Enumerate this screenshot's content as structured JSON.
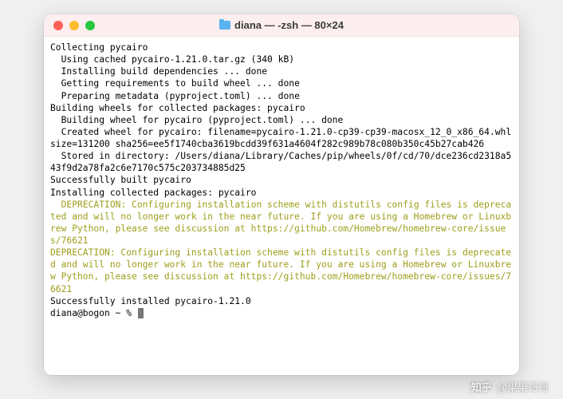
{
  "window": {
    "title": "diana — -zsh — 80×24"
  },
  "terminal": {
    "lines": [
      {
        "text": "Collecting pycairo",
        "cls": ""
      },
      {
        "text": "  Using cached pycairo-1.21.0.tar.gz (340 kB)",
        "cls": ""
      },
      {
        "text": "  Installing build dependencies ... done",
        "cls": ""
      },
      {
        "text": "  Getting requirements to build wheel ... done",
        "cls": ""
      },
      {
        "text": "  Preparing metadata (pyproject.toml) ... done",
        "cls": ""
      },
      {
        "text": "Building wheels for collected packages: pycairo",
        "cls": ""
      },
      {
        "text": "  Building wheel for pycairo (pyproject.toml) ... done",
        "cls": ""
      },
      {
        "text": "  Created wheel for pycairo: filename=pycairo-1.21.0-cp39-cp39-macosx_12_0_x86_64.whl size=131200 sha256=ee5f1740cba3619bcdd39f631a4604f282c989b78c080b350c45b27cab426",
        "cls": ""
      },
      {
        "text": "  Stored in directory: /Users/diana/Library/Caches/pip/wheels/0f/cd/70/dce236cd2318a543f9d2a78fa2c6e7170c575c203734885d25",
        "cls": ""
      },
      {
        "text": "Successfully built pycairo",
        "cls": ""
      },
      {
        "text": "Installing collected packages: pycairo",
        "cls": ""
      },
      {
        "text": "  DEPRECATION: Configuring installation scheme with distutils config files is deprecated and will no longer work in the near future. If you are using a Homebrew or Linuxbrew Python, please see discussion at https://github.com/Homebrew/homebrew-core/issues/76621",
        "cls": "yellow"
      },
      {
        "text": "DEPRECATION: Configuring installation scheme with distutils config files is deprecated and will no longer work in the near future. If you are using a Homebrew or Linuxbrew Python, please see discussion at https://github.com/Homebrew/homebrew-core/issues/76621",
        "cls": "yellow"
      },
      {
        "text": "Successfully installed pycairo-1.21.0",
        "cls": ""
      }
    ],
    "prompt": "diana@bogon ~ % "
  },
  "watermark": {
    "logo": "知乎",
    "text": "@果果哥哥"
  }
}
